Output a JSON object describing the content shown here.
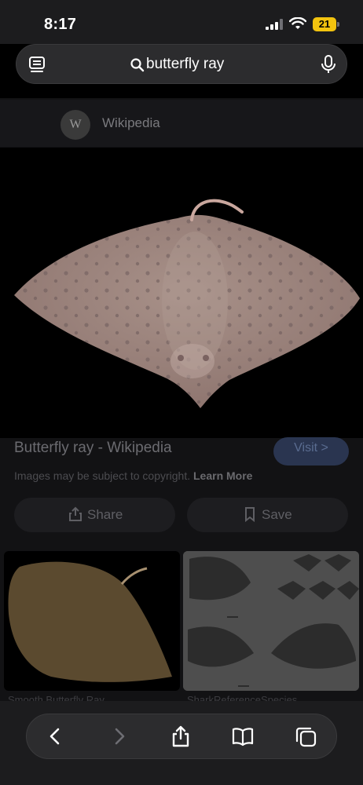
{
  "status": {
    "time": "8:17",
    "battery": "21"
  },
  "address_bar": {
    "query": "butterfly ray"
  },
  "result": {
    "source": "Wikipedia",
    "source_logo": "W",
    "title": "Butterfly ray - Wikipedia",
    "visit_label": "Visit >",
    "copyright_text": "Images may be subject to copyright.",
    "learn_more": "Learn More",
    "share_label": "Share",
    "save_label": "Save"
  },
  "related": [
    {
      "caption": "Smooth Butterfly Ray"
    },
    {
      "caption": "SharkReferenceSpecies"
    }
  ],
  "colors": {
    "battery": "#f2c30f",
    "background": "#000000",
    "ray": "#9a7f7a"
  },
  "icons": [
    "reader-icon",
    "search-icon",
    "mic-icon",
    "back-icon",
    "forward-icon",
    "share-icon",
    "bookmarks-icon",
    "tabs-icon"
  ]
}
